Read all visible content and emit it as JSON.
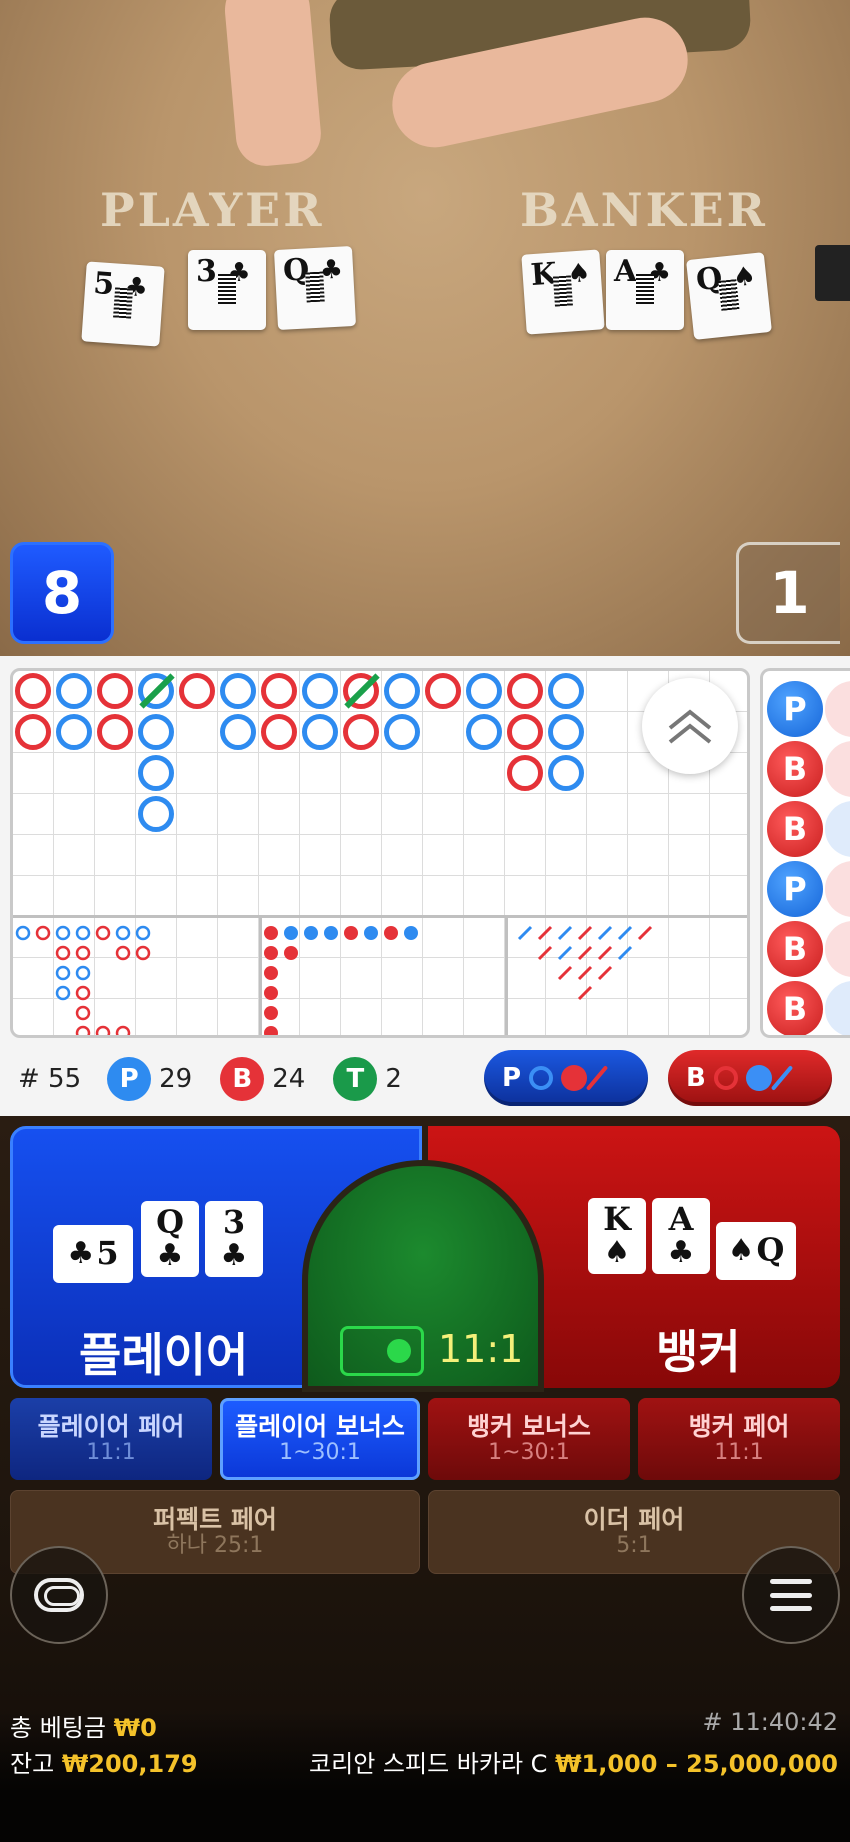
{
  "table": {
    "player_label": "PLAYER",
    "banker_label": "BANKER",
    "player_cards": [
      {
        "value": "5",
        "suit": "♣"
      },
      {
        "value": "3",
        "suit": "♣"
      },
      {
        "value": "Q",
        "suit": "♣"
      }
    ],
    "banker_cards": [
      {
        "value": "K",
        "suit": "♠"
      },
      {
        "value": "A",
        "suit": "♣"
      },
      {
        "value": "Q",
        "suit": "♠"
      }
    ],
    "player_score": "8",
    "banker_score": "1"
  },
  "roads": {
    "bead_plate": [
      "P",
      "B",
      "B",
      "P",
      "B",
      "B"
    ]
  },
  "stats": {
    "round": "# 55",
    "player_label": "P",
    "player_count": "29",
    "banker_label": "B",
    "banker_count": "24",
    "tie_label": "T",
    "tie_count": "2",
    "predict_player": "P",
    "predict_banker": "B"
  },
  "bets": {
    "player_label": "플레이어",
    "banker_label": "뱅커",
    "tie_odds": "11:1",
    "player_cards": [
      {
        "value": "5",
        "suit": "♣"
      },
      {
        "value": "Q",
        "suit": "♣"
      },
      {
        "value": "3",
        "suit": "♣"
      }
    ],
    "banker_cards": [
      {
        "value": "K",
        "suit": "♠"
      },
      {
        "value": "A",
        "suit": "♣"
      },
      {
        "value": "Q",
        "suit": "♠"
      }
    ],
    "side": [
      {
        "title": "플레이어 페어",
        "odds": "11:1"
      },
      {
        "title": "플레이어 보너스",
        "odds": "1~30:1"
      },
      {
        "title": "뱅커 보너스",
        "odds": "1~30:1"
      },
      {
        "title": "뱅커 페어",
        "odds": "11:1"
      },
      {
        "title": "퍼펙트 페어",
        "odds": "하나 25:1"
      },
      {
        "title": "이더 페어",
        "odds": "5:1"
      }
    ]
  },
  "footer": {
    "total_bet_label": "총 베팅금",
    "total_bet_value": "₩0",
    "balance_label": "잔고",
    "balance_value": "₩200,179",
    "time": "# 11:40:42",
    "table_name": "코리안 스피드 바카라 C",
    "limits": "₩1,000 – 25,000,000"
  },
  "colors": {
    "player_blue": "#1650f0",
    "banker_red": "#cc1414",
    "tie_green": "#1c8a2e",
    "accent_gold": "#f4c22a"
  }
}
